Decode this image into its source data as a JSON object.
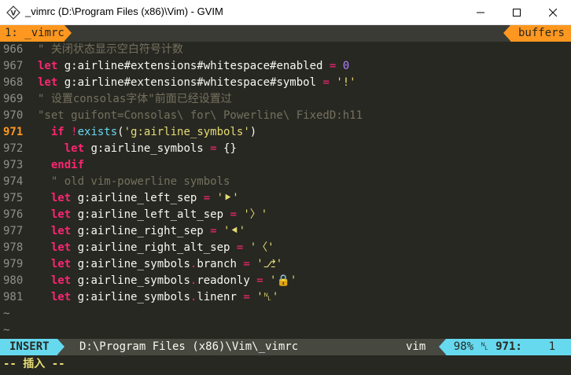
{
  "window": {
    "title": "_vimrc (D:\\Program Files (x86)\\Vim) - GVIM",
    "icon": "gvim-icon"
  },
  "tabline": {
    "active_tab": "1: _vimrc",
    "buffers_label": "buffers"
  },
  "lines": [
    {
      "num": "966",
      "segments": [
        {
          "t": "\" 关闭状态显示空白符号计数",
          "c": "cm"
        }
      ]
    },
    {
      "num": "967",
      "segments": [
        {
          "t": "let",
          "c": "kw"
        },
        {
          "t": " g:airline#extensions#whitespace#enabled ",
          "c": ""
        },
        {
          "t": "=",
          "c": "op"
        },
        {
          "t": " ",
          "c": ""
        },
        {
          "t": "0",
          "c": "num"
        }
      ]
    },
    {
      "num": "968",
      "segments": [
        {
          "t": "let",
          "c": "kw"
        },
        {
          "t": " g:airline#extensions#whitespace#symbol ",
          "c": ""
        },
        {
          "t": "=",
          "c": "op"
        },
        {
          "t": " ",
          "c": ""
        },
        {
          "t": "'!'",
          "c": "str"
        }
      ]
    },
    {
      "num": "969",
      "segments": [
        {
          "t": "\" 设置consolas字体\"前面已经设置过",
          "c": "cm"
        }
      ]
    },
    {
      "num": "970",
      "segments": [
        {
          "t": "\"set guifont=Consolas\\ for\\ Powerline\\ FixedD:h11",
          "c": "cm"
        }
      ]
    },
    {
      "num": "971",
      "current": true,
      "segments": [
        {
          "t": "  ",
          "c": ""
        },
        {
          "t": "if",
          "c": "kw"
        },
        {
          "t": " ",
          "c": ""
        },
        {
          "t": "!",
          "c": "op"
        },
        {
          "t": "exists",
          "c": "fn"
        },
        {
          "t": "(",
          "c": ""
        },
        {
          "t": "'g:airline_symbols'",
          "c": "str"
        },
        {
          "t": ")",
          "c": ""
        }
      ]
    },
    {
      "num": "972",
      "segments": [
        {
          "t": "    ",
          "c": ""
        },
        {
          "t": "let",
          "c": "kw"
        },
        {
          "t": " g:airline_symbols ",
          "c": ""
        },
        {
          "t": "=",
          "c": "op"
        },
        {
          "t": " {}",
          "c": ""
        }
      ]
    },
    {
      "num": "973",
      "segments": [
        {
          "t": "  ",
          "c": ""
        },
        {
          "t": "endif",
          "c": "kw"
        }
      ]
    },
    {
      "num": "974",
      "segments": [
        {
          "t": "  \" old vim-powerline symbols",
          "c": "cm"
        }
      ]
    },
    {
      "num": "975",
      "segments": [
        {
          "t": "  ",
          "c": ""
        },
        {
          "t": "let",
          "c": "kw"
        },
        {
          "t": " g:airline_left_sep ",
          "c": ""
        },
        {
          "t": "=",
          "c": "op"
        },
        {
          "t": " ",
          "c": ""
        },
        {
          "t": "'⯈'",
          "c": "str"
        }
      ]
    },
    {
      "num": "976",
      "segments": [
        {
          "t": "  ",
          "c": ""
        },
        {
          "t": "let",
          "c": "kw"
        },
        {
          "t": " g:airline_left_alt_sep ",
          "c": ""
        },
        {
          "t": "=",
          "c": "op"
        },
        {
          "t": " ",
          "c": ""
        },
        {
          "t": "'〉'",
          "c": "str"
        }
      ]
    },
    {
      "num": "977",
      "segments": [
        {
          "t": "  ",
          "c": ""
        },
        {
          "t": "let",
          "c": "kw"
        },
        {
          "t": " g:airline_right_sep ",
          "c": ""
        },
        {
          "t": "=",
          "c": "op"
        },
        {
          "t": " ",
          "c": ""
        },
        {
          "t": "'⯇'",
          "c": "str"
        }
      ]
    },
    {
      "num": "978",
      "segments": [
        {
          "t": "  ",
          "c": ""
        },
        {
          "t": "let",
          "c": "kw"
        },
        {
          "t": " g:airline_right_alt_sep ",
          "c": ""
        },
        {
          "t": "=",
          "c": "op"
        },
        {
          "t": " ",
          "c": ""
        },
        {
          "t": "'〈'",
          "c": "str"
        }
      ]
    },
    {
      "num": "979",
      "segments": [
        {
          "t": "  ",
          "c": ""
        },
        {
          "t": "let",
          "c": "kw"
        },
        {
          "t": " g:airline_symbols",
          "c": ""
        },
        {
          "t": ".",
          "c": "op"
        },
        {
          "t": "branch ",
          "c": ""
        },
        {
          "t": "=",
          "c": "op"
        },
        {
          "t": " ",
          "c": ""
        },
        {
          "t": "'⎇'",
          "c": "str"
        }
      ]
    },
    {
      "num": "980",
      "segments": [
        {
          "t": "  ",
          "c": ""
        },
        {
          "t": "let",
          "c": "kw"
        },
        {
          "t": " g:airline_symbols",
          "c": ""
        },
        {
          "t": ".",
          "c": "op"
        },
        {
          "t": "readonly ",
          "c": ""
        },
        {
          "t": "=",
          "c": "op"
        },
        {
          "t": " ",
          "c": ""
        },
        {
          "t": "'🔒'",
          "c": "str"
        }
      ]
    },
    {
      "num": "981",
      "segments": [
        {
          "t": "  ",
          "c": ""
        },
        {
          "t": "let",
          "c": "kw"
        },
        {
          "t": " g:airline_symbols",
          "c": ""
        },
        {
          "t": ".",
          "c": "op"
        },
        {
          "t": "linenr ",
          "c": ""
        },
        {
          "t": "=",
          "c": "op"
        },
        {
          "t": " ",
          "c": ""
        },
        {
          "t": "'␤'",
          "c": "str"
        }
      ]
    }
  ],
  "empty_lines": [
    "~",
    "~"
  ],
  "statusline": {
    "mode": "INSERT",
    "file_path": "D:\\Program Files (x86)\\Vim\\_vimrc",
    "filetype": "vim",
    "percent": "98%",
    "linenr_symbol": "␤",
    "line": "971:",
    "column": "1"
  },
  "cmdline": "-- 插入 --",
  "colors": {
    "background": "#272822",
    "accent_orange": "#fd971f",
    "accent_cyan": "#66d9ef",
    "keyword": "#f92672",
    "string": "#e6db74",
    "comment": "#75715e"
  }
}
